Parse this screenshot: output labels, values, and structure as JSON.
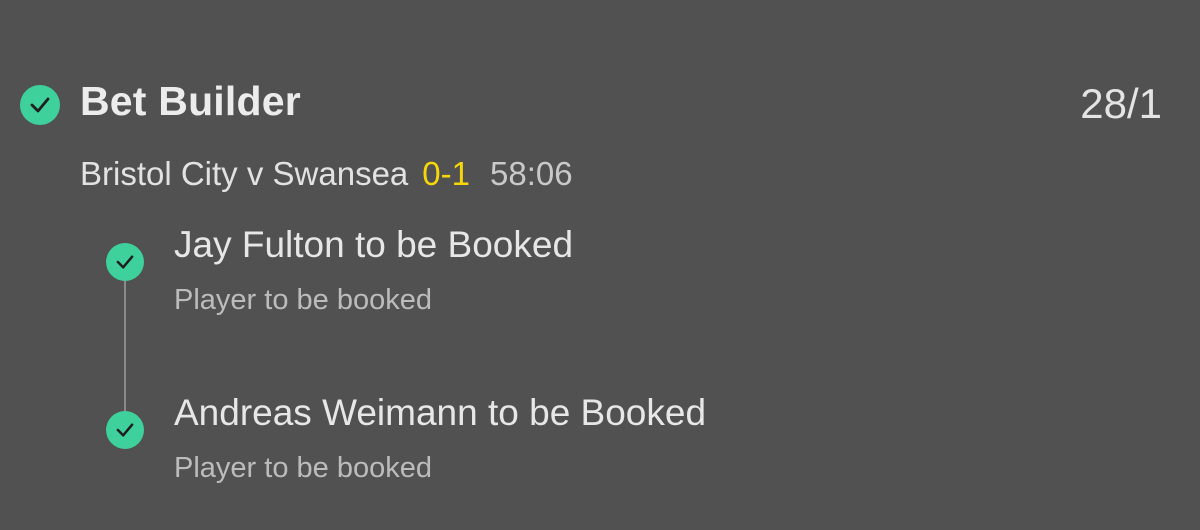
{
  "bet": {
    "title": "Bet Builder",
    "odds": "28/1",
    "status_icon": "check-circle-icon",
    "status_color": "#3fd19c"
  },
  "match": {
    "teams": "Bristol City v Swansea",
    "score": "0-1",
    "clock": "58:06",
    "score_color": "#f6d80a"
  },
  "selections": [
    {
      "title": "Jay Fulton to be Booked",
      "market": "Player to be booked",
      "status_icon": "check-circle-icon"
    },
    {
      "title": "Andreas Weimann to be Booked",
      "market": "Player to be booked",
      "status_icon": "check-circle-icon"
    }
  ],
  "colors": {
    "background": "#515151",
    "text_primary": "#e9e9e9",
    "text_secondary": "#bcbcbc",
    "timeline": "#8a8a8a"
  }
}
